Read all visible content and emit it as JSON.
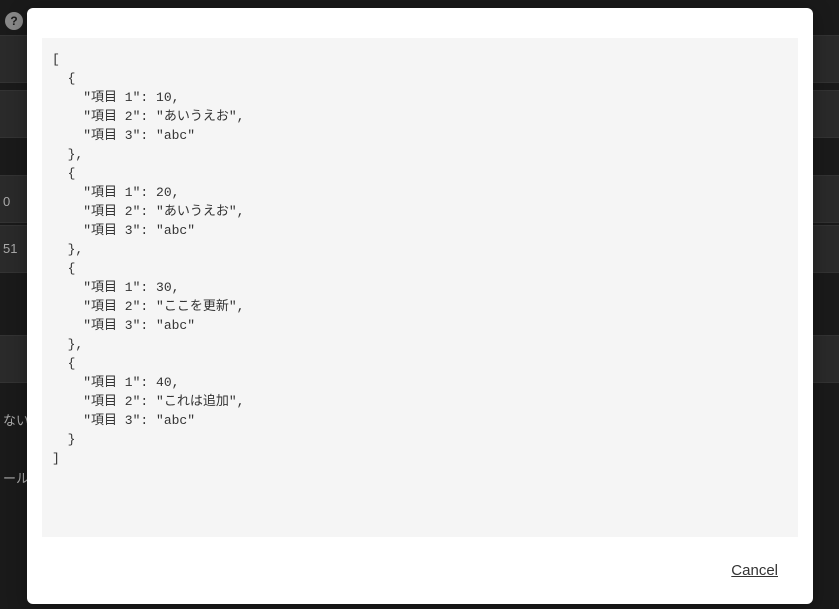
{
  "background": {
    "text1": "0",
    "text2": "51",
    "text3": "ない",
    "text4": "ール"
  },
  "modal": {
    "code": "[\n  {\n    \"項目 1\": 10,\n    \"項目 2\": \"あいうえお\",\n    \"項目 3\": \"abc\"\n  },\n  {\n    \"項目 1\": 20,\n    \"項目 2\": \"あいうえお\",\n    \"項目 3\": \"abc\"\n  },\n  {\n    \"項目 1\": 30,\n    \"項目 2\": \"ここを更新\",\n    \"項目 3\": \"abc\"\n  },\n  {\n    \"項目 1\": 40,\n    \"項目 2\": \"これは追加\",\n    \"項目 3\": \"abc\"\n  }\n]",
    "cancel_label": "Cancel"
  }
}
